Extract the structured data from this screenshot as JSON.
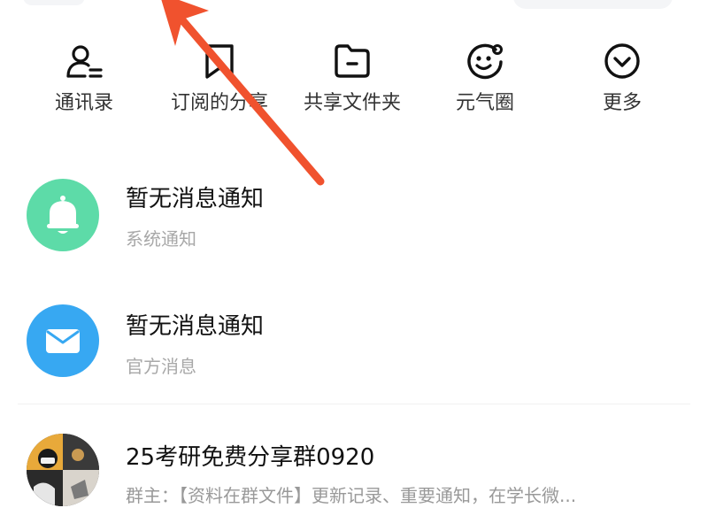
{
  "quick_actions": [
    {
      "label": "通讯录",
      "icon": "contacts-icon"
    },
    {
      "label": "订阅的分享",
      "icon": "bookmark-icon"
    },
    {
      "label": "共享文件夹",
      "icon": "folder-icon"
    },
    {
      "label": "元气圈",
      "icon": "smile-circle-icon"
    },
    {
      "label": "更多",
      "icon": "chevron-down-circle-icon"
    }
  ],
  "messages": [
    {
      "title": "暂无消息通知",
      "subtitle": "系统通知",
      "avatar": "bell-icon",
      "color": "#5ddba8"
    },
    {
      "title": "暂无消息通知",
      "subtitle": "官方消息",
      "avatar": "mail-icon",
      "color": "#37a8f2"
    },
    {
      "title": "25考研免费分享群0920",
      "subtitle": "群主：【资料在群文件】更新记录、重要通知，在学长微...",
      "avatar": "group-avatar"
    }
  ],
  "colors": {
    "arrow": "#f0522e",
    "text_primary": "#111111",
    "text_secondary": "#a8a8a8"
  }
}
